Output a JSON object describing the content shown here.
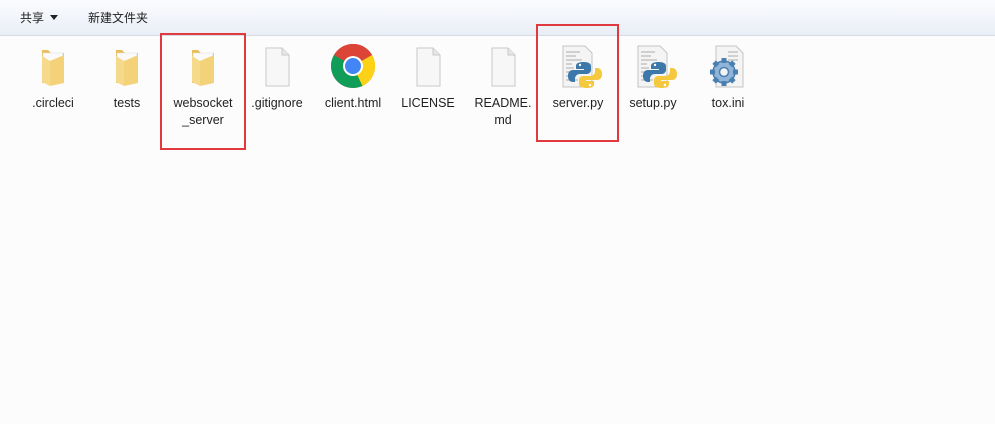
{
  "toolbar": {
    "share_label": "共享",
    "new_folder_label": "新建文件夹"
  },
  "files": [
    {
      "name": ".circleci",
      "type": "folder",
      "icon": "folder-icon"
    },
    {
      "name": "tests",
      "type": "folder",
      "icon": "folder-icon"
    },
    {
      "name": "websocket_server",
      "line1": "websocket",
      "line2": "_server",
      "type": "folder",
      "icon": "folder-icon",
      "highlighted": true
    },
    {
      "name": ".gitignore",
      "type": "file",
      "icon": "blank-file-icon"
    },
    {
      "name": "client.html",
      "type": "file",
      "icon": "chrome-icon"
    },
    {
      "name": "LICENSE",
      "type": "file",
      "icon": "blank-file-icon"
    },
    {
      "name": "README.md",
      "line1": "README.",
      "line2": "md",
      "type": "file",
      "icon": "blank-file-icon"
    },
    {
      "name": "server.py",
      "type": "file",
      "icon": "python-file-icon",
      "highlighted": true
    },
    {
      "name": "setup.py",
      "type": "file",
      "icon": "python-file-icon"
    },
    {
      "name": "tox.ini",
      "type": "file",
      "icon": "settings-file-icon"
    }
  ],
  "colors": {
    "highlight": "#e0393e",
    "folder": "#f4d27a"
  }
}
